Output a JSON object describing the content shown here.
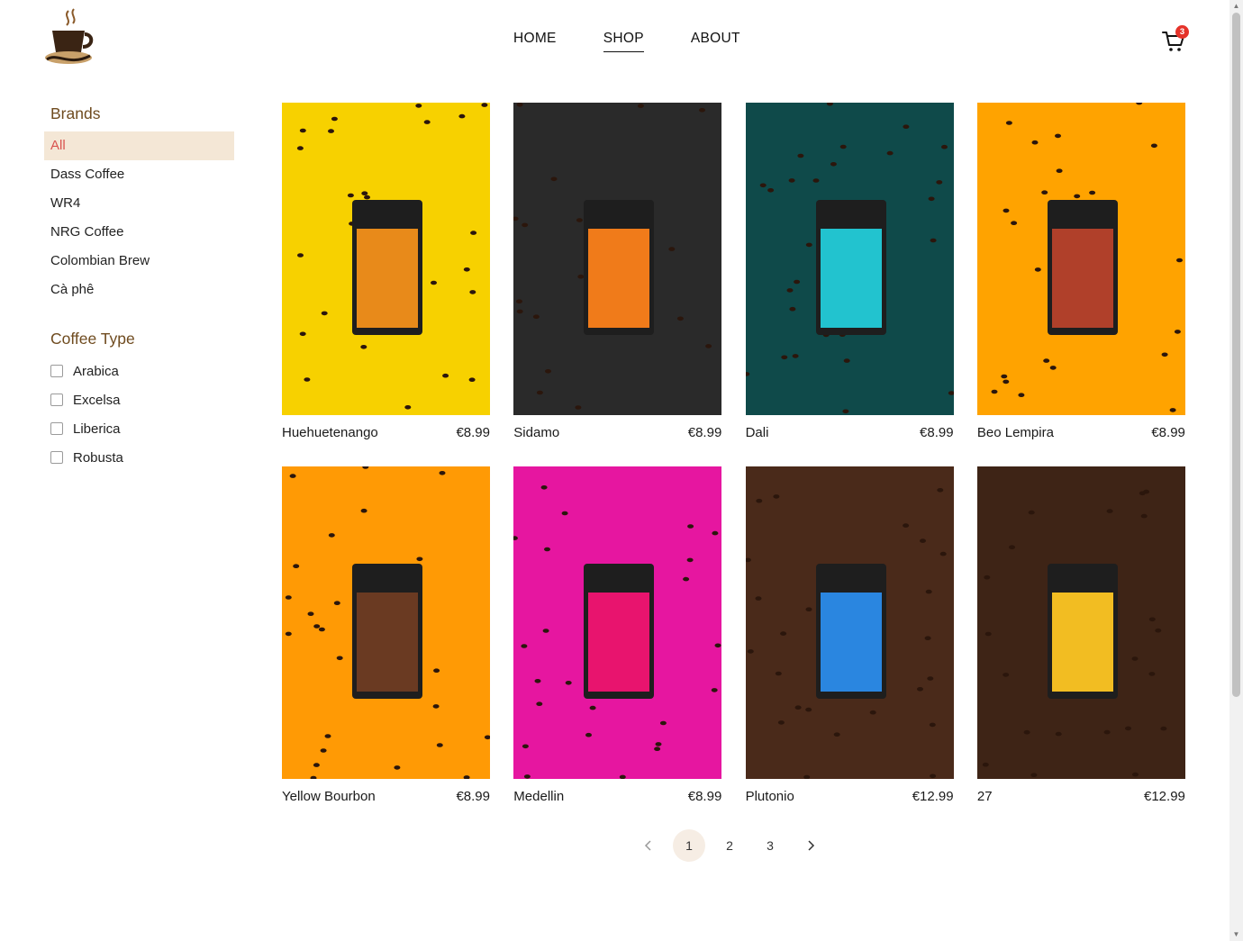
{
  "header": {
    "logo_icon": "coffee-cup-logo-icon",
    "nav": [
      {
        "label": "HOME",
        "active": false
      },
      {
        "label": "SHOP",
        "active": true
      },
      {
        "label": "ABOUT",
        "active": false
      }
    ],
    "cart_icon": "shopping-cart-icon",
    "cart_count": "3"
  },
  "sidebar": {
    "brands_title": "Brands",
    "brands": [
      "All",
      "Dass Coffee",
      "WR4",
      "NRG Coffee",
      "Colombian Brew",
      "Cà phê"
    ],
    "selected_brand": "All",
    "type_title": "Coffee Type",
    "types": [
      "Arabica",
      "Excelsa",
      "Liberica",
      "Robusta"
    ]
  },
  "products": [
    {
      "name": "Huehuetenango",
      "price": "€8.99",
      "bg": "#f7d100",
      "bag": "#e88a1a"
    },
    {
      "name": "Sidamo",
      "price": "€8.99",
      "bg": "#2a2a2a",
      "bag": "#f07b1a"
    },
    {
      "name": "Dali",
      "price": "€8.99",
      "bg": "#0f4a4a",
      "bag": "#22c3cf"
    },
    {
      "name": "Beo Lempira",
      "price": "€8.99",
      "bg": "#ffa300",
      "bag": "#b0402a"
    },
    {
      "name": "Yellow Bourbon",
      "price": "€8.99",
      "bg": "#ff9a05",
      "bag": "#6a3a22"
    },
    {
      "name": "Medellin",
      "price": "€8.99",
      "bg": "#e616a0",
      "bag": "#e8146e"
    },
    {
      "name": "Plutonio",
      "price": "€12.99",
      "bg": "#4a2a1a",
      "bag": "#2a86e0"
    },
    {
      "name": "27",
      "price": "€12.99",
      "bg": "#3e2416",
      "bag": "#f2bd22"
    }
  ],
  "pagination": {
    "pages": [
      "1",
      "2",
      "3"
    ],
    "current": "1",
    "prev_icon": "chevron-left-icon",
    "next_icon": "chevron-right-icon"
  }
}
